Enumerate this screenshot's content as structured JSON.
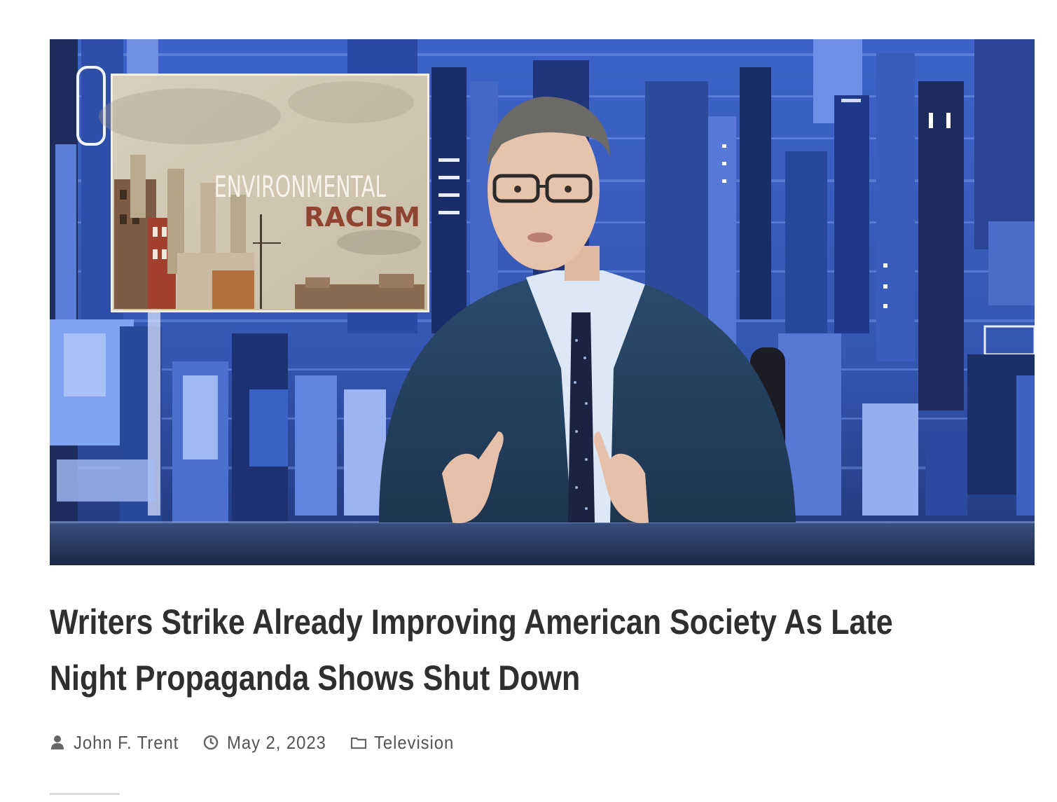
{
  "article": {
    "title": "Writers Strike Already Improving American Society As Late Night Propaganda Shows Shut Down",
    "author": "John F. Trent",
    "date": "May 2, 2023",
    "category": "Television"
  },
  "hero_image": {
    "inset_title_line1": "ENVIRONMENTAL",
    "inset_title_line2": "RACISM"
  },
  "icons": {
    "author": "user-icon",
    "date": "clock-icon",
    "category": "folder-icon"
  },
  "colors": {
    "title": "#2f2f2f",
    "meta": "#555555",
    "hero_bg": "#2c4fa3"
  }
}
